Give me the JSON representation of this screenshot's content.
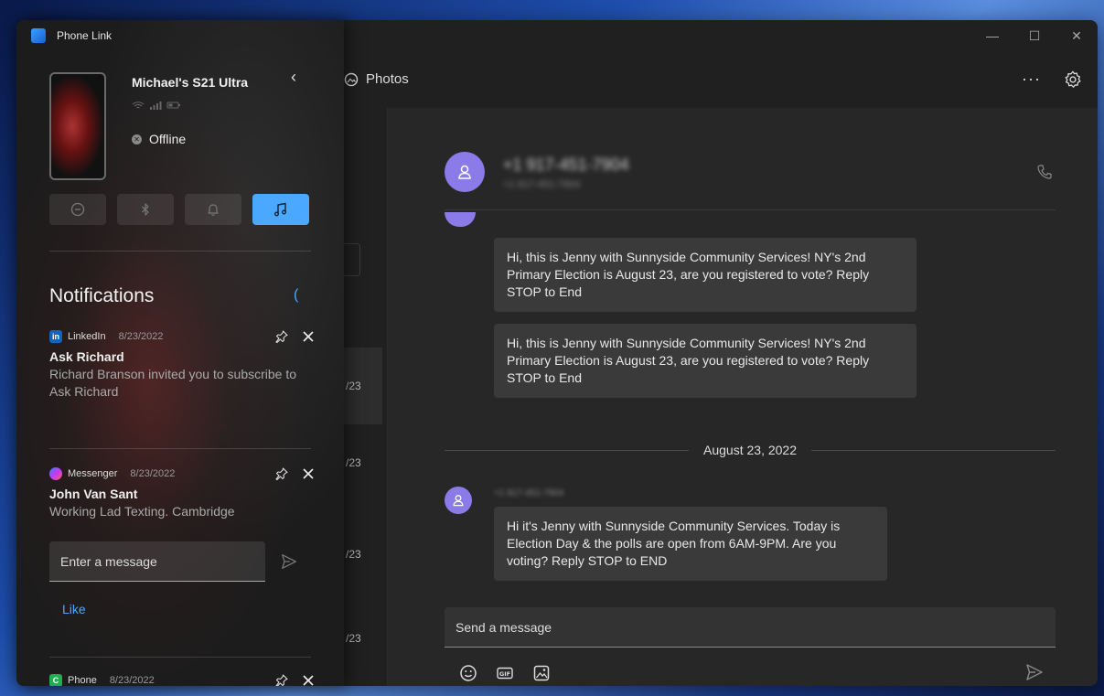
{
  "app": {
    "title": "Phone Link"
  },
  "window_controls": {
    "minimize": "—",
    "maximize": "☐",
    "close": "✕"
  },
  "topbar": {
    "photos_label": "Photos",
    "more_label": "···"
  },
  "device": {
    "name": "Michael's S21 Ultra",
    "status": "Offline",
    "collapse": "‹"
  },
  "quick_actions": [
    {
      "icon": "do-not-disturb-icon",
      "active": false
    },
    {
      "icon": "bluetooth-icon",
      "active": false
    },
    {
      "icon": "bell-icon",
      "active": false
    },
    {
      "icon": "music-icon",
      "active": true
    }
  ],
  "notifications": {
    "heading": "Notifications",
    "clear": "(",
    "items": [
      {
        "app": "LinkedIn",
        "date": "8/23/2022",
        "title": "Ask Richard",
        "body": "Richard Branson invited you to subscribe to Ask Richard",
        "badge": "in",
        "badge_color": "#0a66c2"
      },
      {
        "app": "Messenger",
        "date": "8/23/2022",
        "title": "John Van Sant",
        "body": "Working Lad Texting. Cambridge",
        "badge": "",
        "badge_color": "#a23cf0"
      },
      {
        "app": "Phone",
        "date": "8/23/2022",
        "title": "",
        "body": "",
        "badge": "C",
        "badge_color": "#1fae52"
      }
    ],
    "reply_placeholder": "Enter a message",
    "like": "Like"
  },
  "conversation_list": {
    "items": [
      "/23",
      "/23",
      "/23",
      "/23"
    ]
  },
  "chat": {
    "contact_name": "+1 917-451-7904",
    "contact_sub": "+1 917-451-7904",
    "messages": [
      {
        "text": "Hi, this is Jenny with Sunnyside Community Services! NY's 2nd Primary Election is August 23, are you registered to vote? Reply STOP to End"
      },
      {
        "text": "Hi, this is Jenny with Sunnyside Community Services! NY's 2nd Primary Election is August 23, are you registered to vote? Reply STOP to End"
      },
      {
        "text": "Hi it's Jenny with Sunnyside Community Services. Today is Election Day & the polls are open from 6AM-9PM. Are you voting? Reply STOP to END",
        "sender": "+1 917-451-7904"
      }
    ],
    "date_separator": "August 23, 2022",
    "composer_placeholder": "Send a message"
  },
  "colors": {
    "accent": "#4aa8ff",
    "avatar": "#8a7be8",
    "window_bg": "#202020",
    "chat_bg": "#272727",
    "bubble_bg": "#3a3a3a"
  }
}
